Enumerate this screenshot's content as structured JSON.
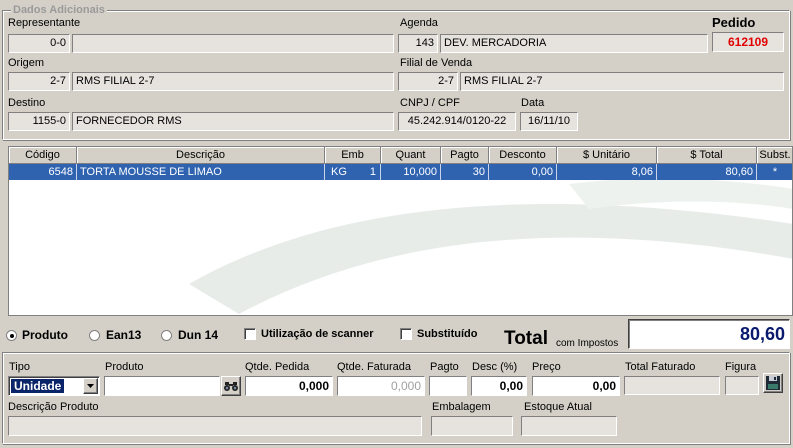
{
  "header": {
    "group_title": "Dados Adicionais",
    "pedido_label": "Pedido",
    "pedido_number": "612109",
    "representante": {
      "label": "Representante",
      "code": "0-0",
      "name": ""
    },
    "agenda": {
      "label": "Agenda",
      "code": "143",
      "name": "DEV. MERCADORIA"
    },
    "origem": {
      "label": "Origem",
      "code": "2-7",
      "name": "RMS FILIAL 2-7"
    },
    "filial_venda": {
      "label": "Filial de Venda",
      "code": "2-7",
      "name": "RMS FILIAL 2-7"
    },
    "destino": {
      "label": "Destino",
      "code": "1155-0",
      "name": "FORNECEDOR RMS"
    },
    "cnpj": {
      "label": "CNPJ / CPF",
      "value": "45.242.914/0120-22"
    },
    "data": {
      "label": "Data",
      "value": "16/11/10"
    }
  },
  "grid": {
    "columns": [
      "Código",
      "Descrição",
      "Emb",
      "Quant",
      "Pagto",
      "Desconto",
      "$ Unitário",
      "$ Total",
      "Subst."
    ],
    "rows": [
      {
        "codigo": "6548",
        "descricao": "TORTA MOUSSE DE LIMAO",
        "emb_unit": "KG",
        "emb_qty": "1",
        "quant": "10,000",
        "pagto": "30",
        "desconto": "0,00",
        "unitario": "8,06",
        "total": "80,60",
        "subst": "*"
      }
    ]
  },
  "options": {
    "produto": "Produto",
    "ean13": "Ean13",
    "dun14": "Dun 14",
    "scanner": "Utilização de scanner",
    "substituido": "Substituído"
  },
  "total": {
    "label": "Total",
    "sub_label": "com Impostos",
    "value": "80,60"
  },
  "entry": {
    "tipo_label": "Tipo",
    "tipo_value": "Unidade",
    "produto_label": "Produto",
    "produto_value": "",
    "qtde_pedida_label": "Qtde. Pedida",
    "qtde_pedida_value": "0,000",
    "qtde_faturada_label": "Qtde. Faturada",
    "qtde_faturada_value": "0,000",
    "pagto_label": "Pagto",
    "pagto_value": "",
    "desc_label": "Desc (%)",
    "desc_value": "0,00",
    "preco_label": "Preço",
    "preco_value": "0,00",
    "total_faturado_label": "Total Faturado",
    "total_faturado_value": "",
    "figura_label": "Figura",
    "descricao_produto_label": "Descrição Produto",
    "embalagem_label": "Embalagem",
    "estoque_label": "Estoque Atual"
  },
  "colors": {
    "selection": "#2f63b0",
    "pedido_red": "#e00000",
    "total_blue": "#0a1a6e"
  }
}
